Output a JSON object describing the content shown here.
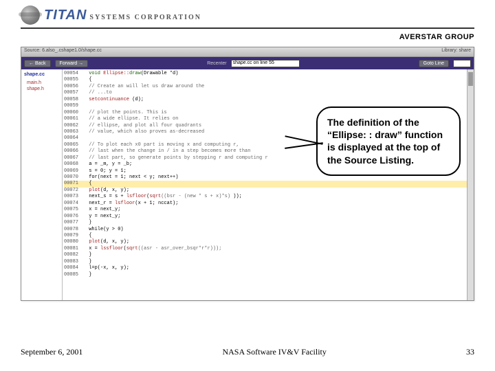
{
  "header": {
    "brand_main": "TITAN",
    "brand_sub": "SYSTEMS CORPORATION",
    "group": "AVERSTAR GROUP"
  },
  "viewer": {
    "title_left": "Source: 6.also_.cshape1.0/shape.cc",
    "title_right": "Library: share",
    "toolbar": {
      "back": "← Back",
      "forward": "Forward →",
      "recenter_label": "Recenter",
      "recenter_value": "shape.cc on line 55",
      "goto": "Goto Line"
    },
    "left_panel": {
      "header": "shape.cc",
      "items": [
        "main.h",
        "shape.h"
      ]
    },
    "code": [
      {
        "n": "00054",
        "t": "void ",
        "a": "Ellipse::",
        "b": "draw",
        "c": "(Drawable *d)"
      },
      {
        "n": "00055",
        "t": "{"
      },
      {
        "n": "00056",
        "t": "  // Create an ",
        "c2": "                      will let us draw around the"
      },
      {
        "n": "00057",
        "t": "  // ...to"
      },
      {
        "n": "00058",
        "t": "  ",
        "a": "setcontinuance",
        "c": " (d);"
      },
      {
        "n": "00059",
        "t": ""
      },
      {
        "n": "00060",
        "t": "  // plot the points. This is"
      },
      {
        "n": "00061",
        "t": "  // a wide ellipse.  It relies on"
      },
      {
        "n": "00062",
        "t": "  // ellipse, and plot all four quadrants"
      },
      {
        "n": "00063",
        "t": "  // value, which also proves as-decreased"
      },
      {
        "n": "00064",
        "t": ""
      },
      {
        "n": "00065",
        "t": "  // To plot each x0 part is moving x and computing r,"
      },
      {
        "n": "00066",
        "t": "  // last when the change in / in a step becomes more than"
      },
      {
        "n": "00067",
        "t": "  // last part, so generate points by stepping r and computing r"
      },
      {
        "n": "00068",
        "t": "  a = _m, y = _b;"
      },
      {
        "n": "00069",
        "t": "  s = 0; y = 1;"
      },
      {
        "n": "00070",
        "t": "  for(next = 1; next < y; next++)"
      },
      {
        "n": "00071",
        "t": "  {",
        "hi": true
      },
      {
        "n": "00072",
        "t": "    ",
        "a": "plot",
        "c": "(d, x, y);"
      },
      {
        "n": "00073",
        "t": "    next_s = s + ",
        "a": "lsfloor",
        "c": "(",
        "a2": "sqrt",
        "c2": "((bsr - (new * s + x)*s)",
        "c3": " ));"
      },
      {
        "n": "00074",
        "t": "    next_r = ",
        "a": "lsfloor",
        "c": "(x + 1; nccat);"
      },
      {
        "n": "00075",
        "t": "    x = next_y;"
      },
      {
        "n": "00076",
        "t": "    y = next_y;"
      },
      {
        "n": "00077",
        "t": "  }"
      },
      {
        "n": "00078",
        "t": "  while(y > 0)"
      },
      {
        "n": "00079",
        "t": "  {"
      },
      {
        "n": "00080",
        "t": "    ",
        "a": "plot",
        "c": "(d, x, y);"
      },
      {
        "n": "00081",
        "t": "    x = ",
        "a": "lssfloor",
        "c": "(",
        "a2": "sqrt",
        "c2": "((asr - asr_over_bsqr*r*r)));"
      },
      {
        "n": "00082",
        "t": "    }"
      },
      {
        "n": "00083",
        "t": "  }"
      },
      {
        "n": "00084",
        "t": "  l=p(-x, x, y);"
      },
      {
        "n": "00085",
        "t": "}"
      }
    ]
  },
  "callout": "The definition of the “Ellipse: : draw” function is displayed at the top of the Source Listing.",
  "footer": {
    "date": "September 6, 2001",
    "center": "NASA Software IV&V Facility",
    "page": "33"
  }
}
